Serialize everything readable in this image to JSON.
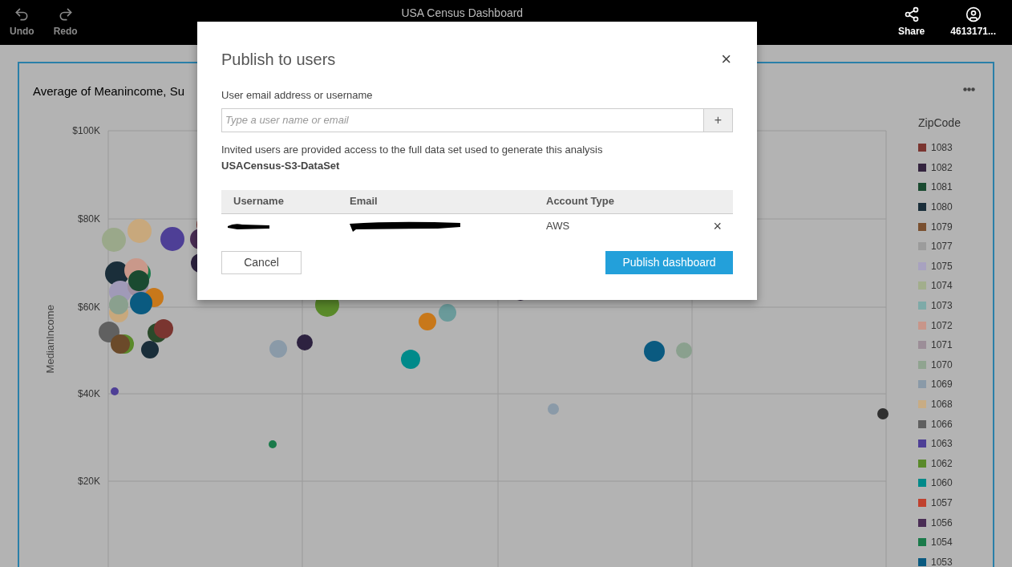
{
  "toolbar": {
    "title": "USA Census Dashboard",
    "left_buttons": [
      {
        "kind": "undo",
        "label": "Undo"
      },
      {
        "kind": "redo",
        "label": "Redo"
      }
    ],
    "right_buttons": [
      {
        "kind": "share",
        "label": "Share"
      },
      {
        "kind": "user",
        "label": "4613171..."
      }
    ]
  },
  "visual": {
    "title": "Average of Meanincome, Su",
    "y_axis_label": "MedianIncome",
    "y_ticks": [
      "$100K",
      "$80K",
      "$60K",
      "$40K",
      "$20K"
    ],
    "legend": {
      "title": "ZipCode",
      "items": [
        {
          "label": "1083",
          "color": "#7a3530"
        },
        {
          "label": "1082",
          "color": "#34243f"
        },
        {
          "label": "1081",
          "color": "#1a4a30"
        },
        {
          "label": "1080",
          "color": "#1a2e3a"
        },
        {
          "label": "1079",
          "color": "#7a5030"
        },
        {
          "label": "1077",
          "color": "#9c9c9c"
        },
        {
          "label": "1075",
          "color": "#a8a2c0"
        },
        {
          "label": "1074",
          "color": "#a2ae8c"
        },
        {
          "label": "1073",
          "color": "#7eaaa8"
        },
        {
          "label": "1072",
          "color": "#c8968a"
        },
        {
          "label": "1071",
          "color": "#9c8e98"
        },
        {
          "label": "1070",
          "color": "#90a490"
        },
        {
          "label": "1069",
          "color": "#8a9aa8"
        },
        {
          "label": "1068",
          "color": "#c8ac84"
        },
        {
          "label": "1066",
          "color": "#606060"
        },
        {
          "label": "1063",
          "color": "#4e3f96"
        },
        {
          "label": "1062",
          "color": "#5a8a2a"
        },
        {
          "label": "1060",
          "color": "#008a8a"
        },
        {
          "label": "1057",
          "color": "#c0412e"
        },
        {
          "label": "1056",
          "color": "#4a2d55"
        },
        {
          "label": "1054",
          "color": "#1a7a4a"
        },
        {
          "label": "1053",
          "color": "#0a5a80"
        }
      ]
    }
  },
  "dialog": {
    "title": "Publish to users",
    "field_label": "User email address or username",
    "placeholder": "Type a user name or email",
    "add_button": "+",
    "note": "Invited users are provided access to the full data set used to generate this analysis\n**USACensus-S3-DataSet**",
    "columns": [
      "Username",
      "Email",
      "Account Type"
    ],
    "rows": [
      {
        "account_type": "AWS",
        "remove": "×"
      }
    ],
    "cancel": "Cancel",
    "publish": "Publish dashboard",
    "close": "×"
  }
}
